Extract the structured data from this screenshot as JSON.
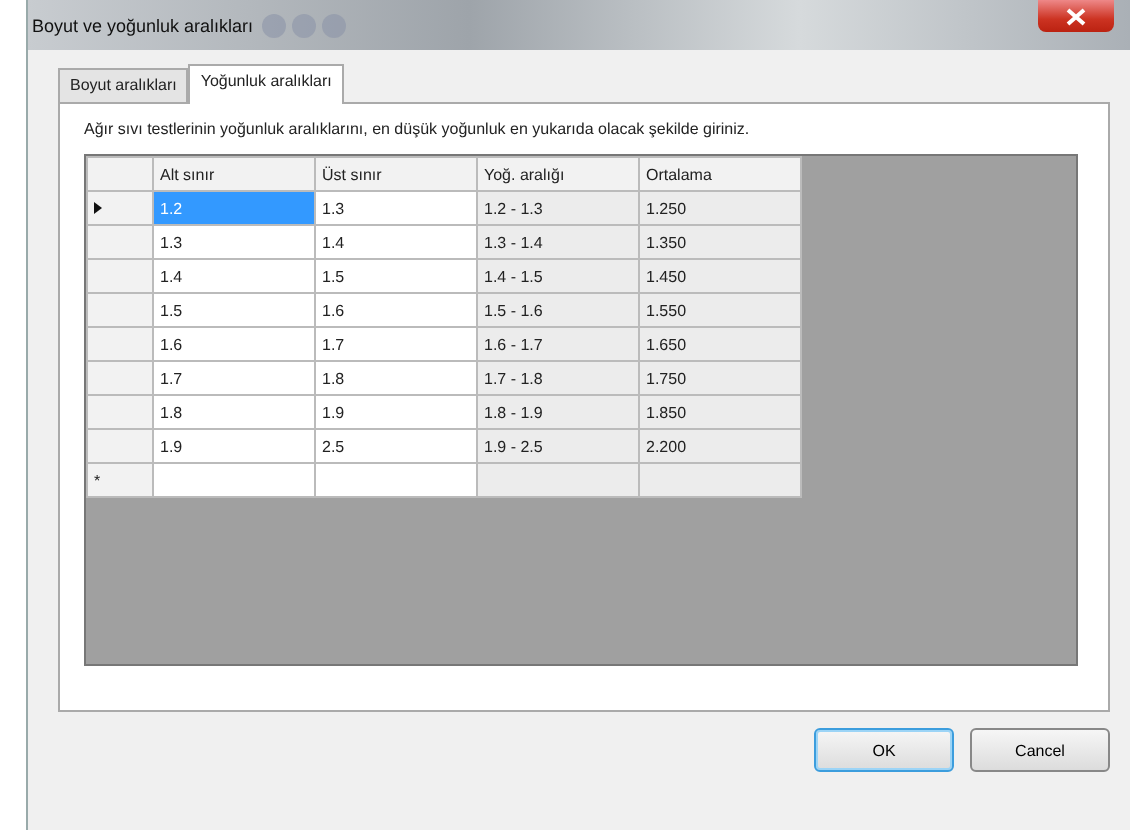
{
  "window": {
    "title": "Boyut ve yoğunluk aralıkları"
  },
  "tabs": [
    {
      "label": "Boyut aralıkları",
      "selected": false
    },
    {
      "label": "Yoğunluk aralıkları",
      "selected": true
    }
  ],
  "instruction": "Ağır sıvı testlerinin yoğunluk aralıklarını, en düşük yoğunluk en yukarıda olacak şekilde giriniz.",
  "grid": {
    "columns": [
      {
        "label": "Alt sınır",
        "readonly": false
      },
      {
        "label": "Üst sınır",
        "readonly": false
      },
      {
        "label": "Yoğ. aralığı",
        "readonly": true
      },
      {
        "label": "Ortalama",
        "readonly": true
      }
    ],
    "rows": [
      {
        "current": true,
        "cells": [
          {
            "text": "1.2",
            "selected": true
          },
          {
            "text": "1.3",
            "selected": false
          },
          {
            "text": "1.2 - 1.3",
            "selected": false
          },
          {
            "text": "1.250",
            "selected": false
          }
        ]
      },
      {
        "current": false,
        "cells": [
          {
            "text": "1.3",
            "selected": false
          },
          {
            "text": "1.4",
            "selected": false
          },
          {
            "text": "1.3 - 1.4",
            "selected": false
          },
          {
            "text": "1.350",
            "selected": false
          }
        ]
      },
      {
        "current": false,
        "cells": [
          {
            "text": "1.4",
            "selected": false
          },
          {
            "text": "1.5",
            "selected": false
          },
          {
            "text": "1.4 - 1.5",
            "selected": false
          },
          {
            "text": "1.450",
            "selected": false
          }
        ]
      },
      {
        "current": false,
        "cells": [
          {
            "text": "1.5",
            "selected": false
          },
          {
            "text": "1.6",
            "selected": false
          },
          {
            "text": "1.5 - 1.6",
            "selected": false
          },
          {
            "text": "1.550",
            "selected": false
          }
        ]
      },
      {
        "current": false,
        "cells": [
          {
            "text": "1.6",
            "selected": false
          },
          {
            "text": "1.7",
            "selected": false
          },
          {
            "text": "1.6 - 1.7",
            "selected": false
          },
          {
            "text": "1.650",
            "selected": false
          }
        ]
      },
      {
        "current": false,
        "cells": [
          {
            "text": "1.7",
            "selected": false
          },
          {
            "text": "1.8",
            "selected": false
          },
          {
            "text": "1.7 - 1.8",
            "selected": false
          },
          {
            "text": "1.750",
            "selected": false
          }
        ]
      },
      {
        "current": false,
        "cells": [
          {
            "text": "1.8",
            "selected": false
          },
          {
            "text": "1.9",
            "selected": false
          },
          {
            "text": "1.8 - 1.9",
            "selected": false
          },
          {
            "text": "1.850",
            "selected": false
          }
        ]
      },
      {
        "current": false,
        "cells": [
          {
            "text": "1.9",
            "selected": false
          },
          {
            "text": "2.5",
            "selected": false
          },
          {
            "text": "1.9 - 2.5",
            "selected": false
          },
          {
            "text": "2.200",
            "selected": false
          }
        ]
      }
    ],
    "new_row_marker": "*"
  },
  "buttons": [
    {
      "label": "OK",
      "default": true
    },
    {
      "label": "Cancel",
      "default": false
    }
  ]
}
